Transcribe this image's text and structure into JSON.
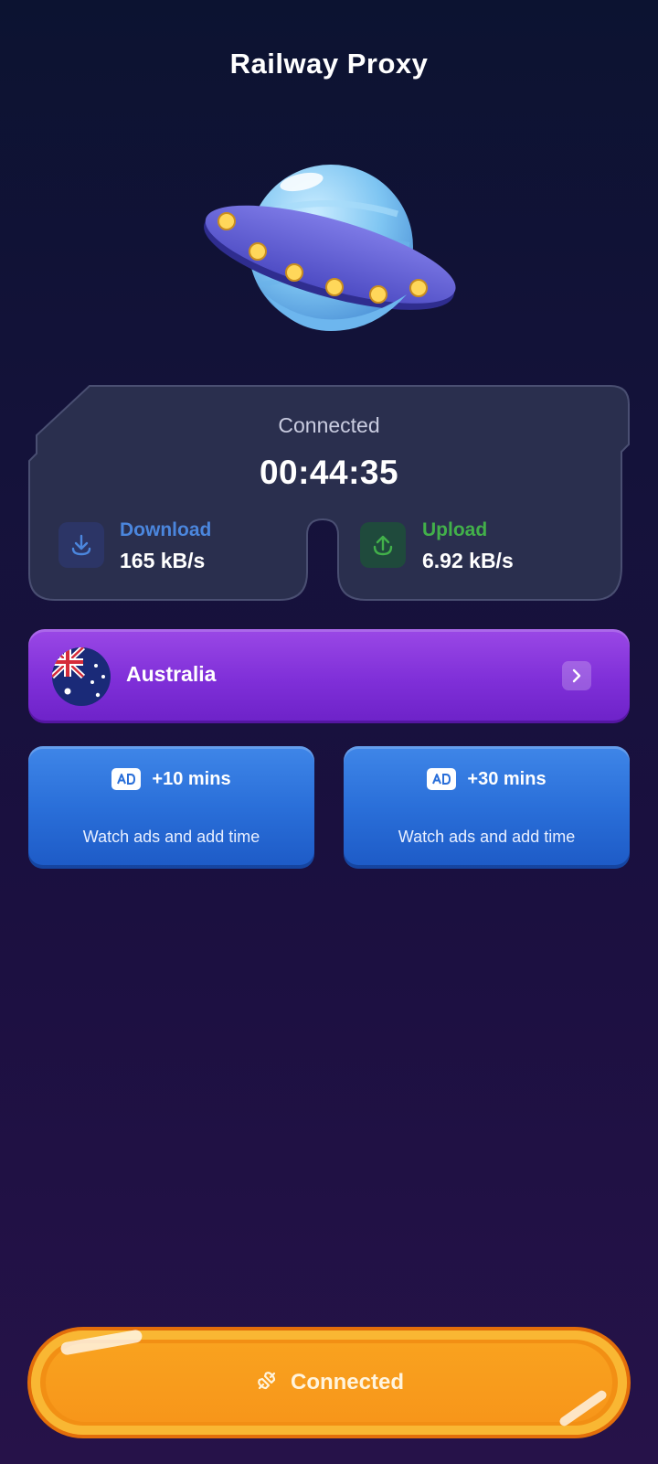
{
  "app": {
    "title": "Railway Proxy"
  },
  "status": {
    "label": "Connected",
    "timer": "00:44:35",
    "download": {
      "label": "Download",
      "value": "165 kB/s",
      "icon": "download-icon"
    },
    "upload": {
      "label": "Upload",
      "value": "6.92 kB/s",
      "icon": "upload-icon"
    }
  },
  "server": {
    "country": "Australia",
    "flag_icon": "australia-flag-icon",
    "chevron_icon": "chevron-right-icon"
  },
  "ad_buttons": [
    {
      "time": "+10 mins",
      "description": "Watch ads and add time",
      "icon": "ad-badge-icon"
    },
    {
      "time": "+30 mins",
      "description": "Watch ads and add time",
      "icon": "ad-badge-icon"
    }
  ],
  "connect_button": {
    "label": "Connected",
    "icon": "plug-icon"
  },
  "colors": {
    "download_accent": "#4b86dd",
    "upload_accent": "#42b04a",
    "server_purple": "#8a36de",
    "ad_blue": "#2a6fd9",
    "connect_orange": "#f7961a"
  }
}
